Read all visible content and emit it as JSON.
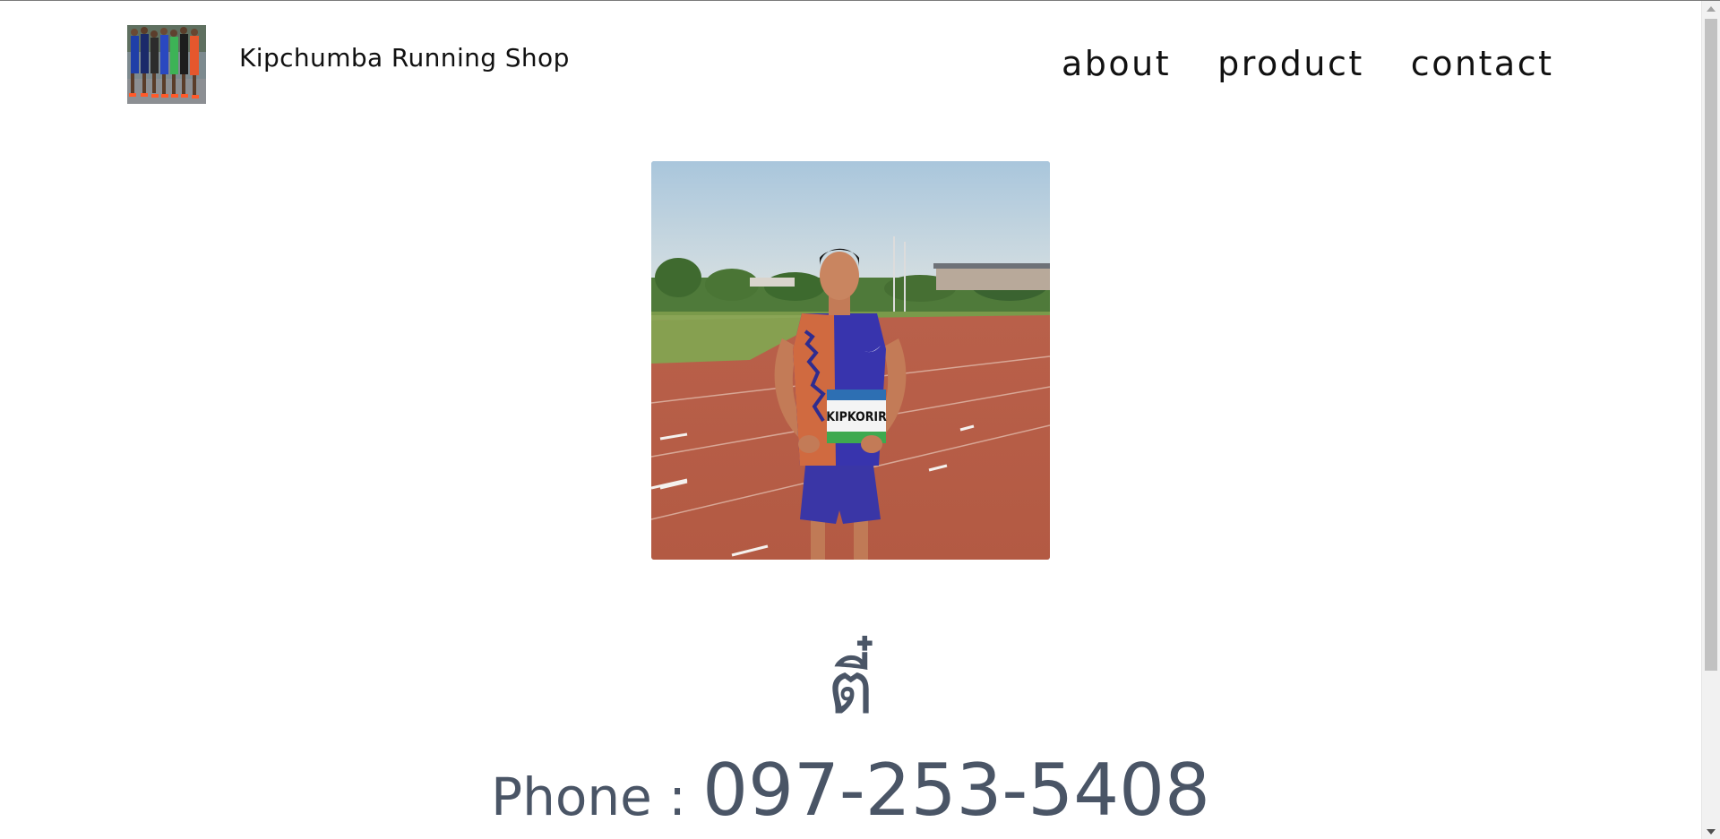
{
  "header": {
    "site_title": "Kipchumba Running Shop",
    "logo_alt": "runners-group-logo"
  },
  "nav": {
    "items": [
      {
        "label": "about"
      },
      {
        "label": "product"
      },
      {
        "label": "contact"
      }
    ]
  },
  "hero": {
    "bib_text": "KIPKORIR"
  },
  "contact": {
    "name": "ตี๋",
    "phone_label": "Phone : ",
    "phone_number": "097-253-5408"
  },
  "colors": {
    "text_primary": "#111111",
    "text_contact": "#4a5566",
    "background": "#ffffff",
    "scrollbar_thumb": "#c1c1c1"
  }
}
